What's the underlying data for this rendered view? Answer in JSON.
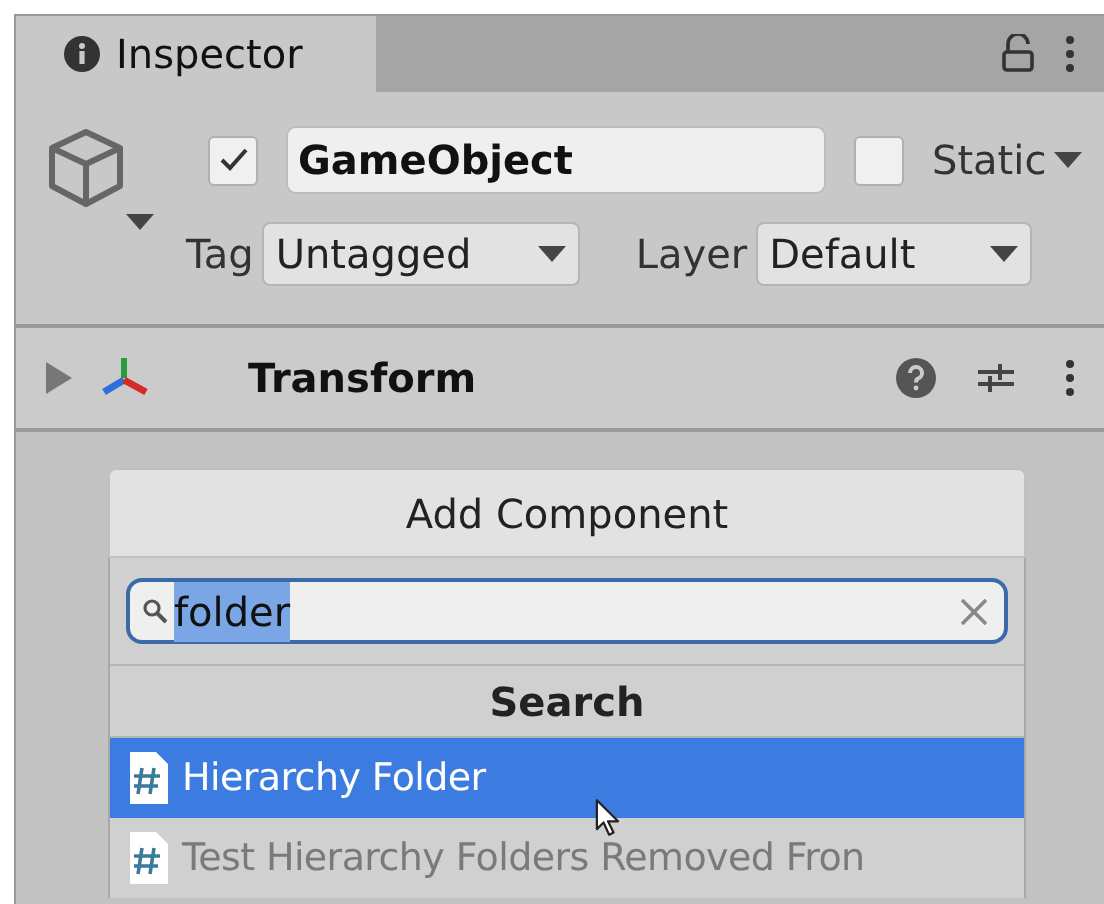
{
  "tab": {
    "label": "Inspector",
    "selected": true
  },
  "object": {
    "active": true,
    "name": "GameObject",
    "static": false,
    "static_label": "Static",
    "tag_label": "Tag",
    "tag": "Untagged",
    "layer_label": "Layer",
    "layer": "Default"
  },
  "component": {
    "expanded": false,
    "title": "Transform"
  },
  "add_component": {
    "button": "Add Component",
    "search_value": "folder",
    "section_title": "Search",
    "results": [
      {
        "label": "Hierarchy Folder",
        "selected": true
      },
      {
        "label": "Test Hierarchy Folders Removed Fron",
        "selected": false
      }
    ]
  }
}
